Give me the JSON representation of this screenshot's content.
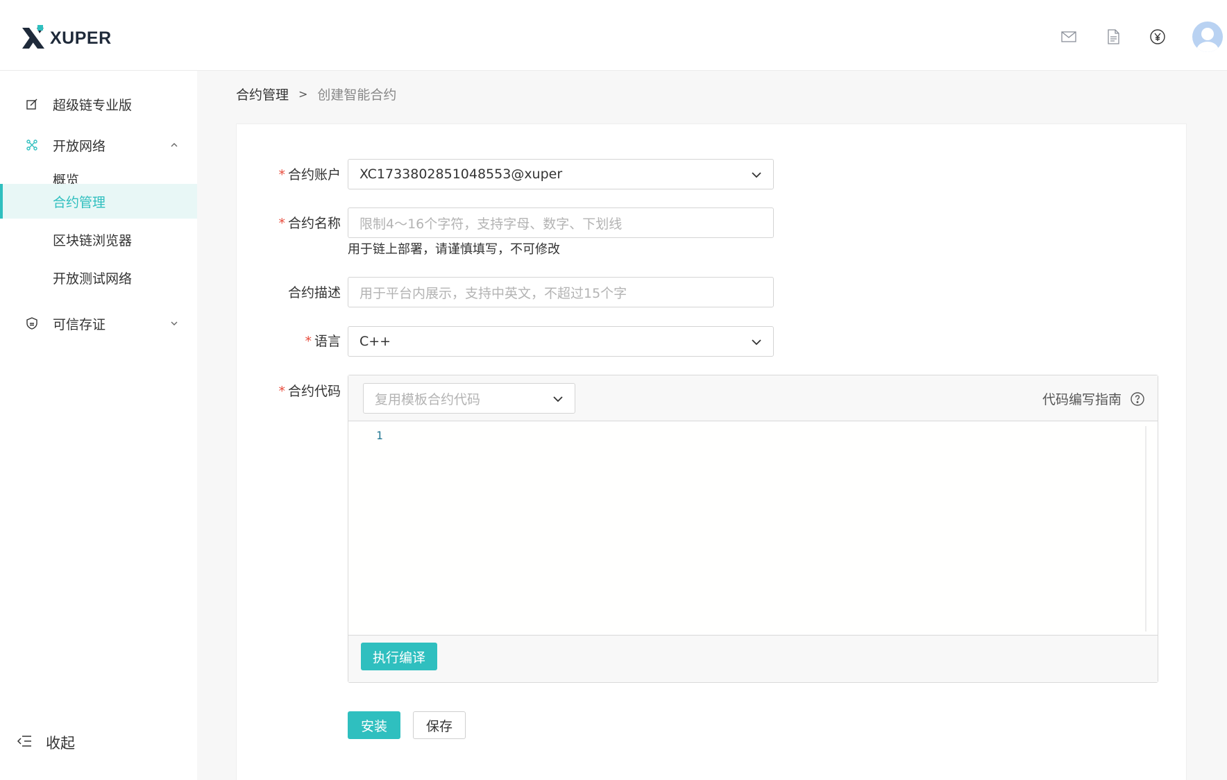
{
  "header": {
    "logo_text": "XUPER",
    "icons": [
      "mail-icon",
      "document-icon",
      "yen-icon",
      "user-avatar"
    ]
  },
  "sidebar": {
    "items": [
      {
        "label": "超级链专业版",
        "icon": "edit-square-icon"
      },
      {
        "label": "开放网络",
        "icon": "network-icon",
        "expanded": true
      },
      {
        "label": "概览"
      },
      {
        "label": "合约管理",
        "active": true
      },
      {
        "label": "区块链浏览器"
      },
      {
        "label": "开放测试网络"
      },
      {
        "label": "可信存证",
        "icon": "shield-icon",
        "expanded": false
      }
    ],
    "collapse_label": "收起"
  },
  "breadcrumb": {
    "parent": "合约管理",
    "separator": ">",
    "current": "创建智能合约"
  },
  "form": {
    "account": {
      "required": "*",
      "label": "合约账户",
      "value": "XC1733802851048553@xuper"
    },
    "name": {
      "required": "*",
      "label": "合约名称",
      "placeholder": "限制4～16个字符，支持字母、数字、下划线",
      "hint": "用于链上部署，请谨慎填写，不可修改"
    },
    "description": {
      "label": "合约描述",
      "placeholder": "用于平台内展示，支持中英文，不超过15个字"
    },
    "language": {
      "required": "*",
      "label": "语言",
      "value": "C++"
    },
    "code": {
      "required": "*",
      "label": "合约代码",
      "template_placeholder": "复用模板合约代码",
      "guide_label": "代码编写指南",
      "line_number": "1",
      "compile_button": "执行编译"
    },
    "install_button": "安装",
    "save_button": "保存"
  },
  "colors": {
    "accent": "#2fbfbf",
    "required": "#e84c3d",
    "active_bg": "#e8f7f6"
  }
}
